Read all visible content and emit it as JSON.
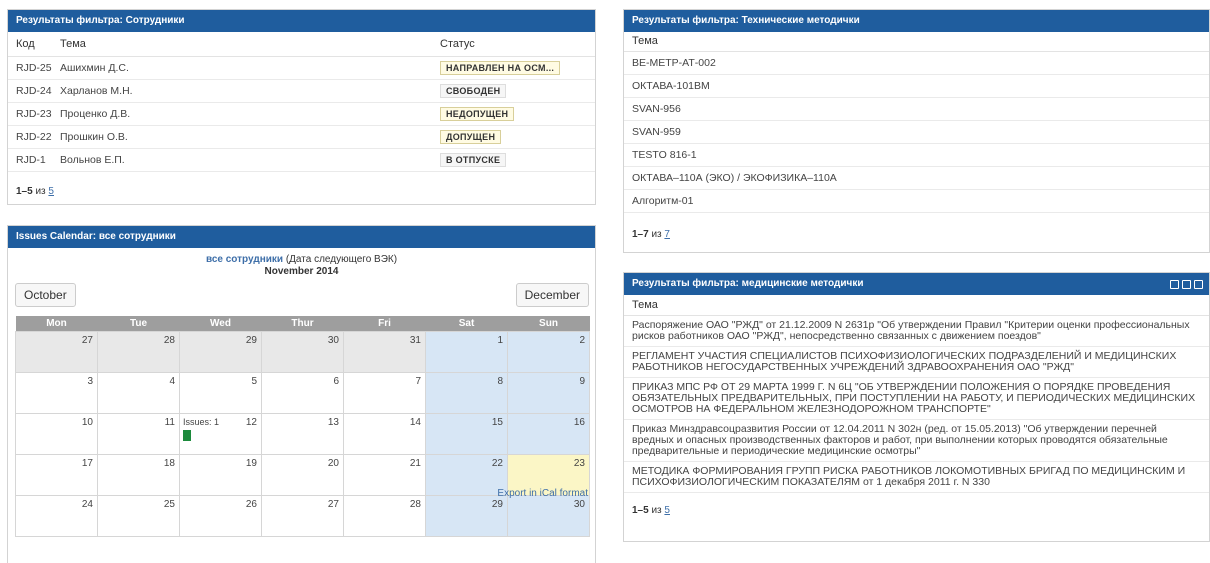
{
  "employees_panel": {
    "title": "Результаты фильтра: Сотрудники",
    "columns": [
      "Код",
      "Тема",
      "Статус"
    ],
    "rows": [
      {
        "code": "RJD-25",
        "name": "Ашихмин Д.С.",
        "status": "НАПРАВЛЕН НА ОСМ..."
      },
      {
        "code": "RJD-24",
        "name": "Харланов М.Н.",
        "status": "СВОБОДЕН"
      },
      {
        "code": "RJD-23",
        "name": "Проценко Д.В.",
        "status": "НЕДОПУЩЕН"
      },
      {
        "code": "RJD-22",
        "name": "Прошкин О.В.",
        "status": "ДОПУЩЕН"
      },
      {
        "code": "RJD-1",
        "name": "Вольнов Е.П.",
        "status": "В ОТПУСКЕ"
      }
    ],
    "pager": {
      "range": "1–5",
      "of": "из",
      "total": "5"
    }
  },
  "calendar_panel": {
    "title": "Issues Calendar: все сотрудники",
    "user_link": "все сотрудники",
    "subtitle": "(Дата следующего ВЭК)",
    "month": "November 2014",
    "prev_label": "October",
    "next_label": "December",
    "weekdays": [
      "Mon",
      "Tue",
      "Wed",
      "Thur",
      "Fri",
      "Sat",
      "Sun"
    ],
    "weeks": [
      [
        "27",
        "28",
        "29",
        "30",
        "31",
        "1",
        "2"
      ],
      [
        "3",
        "4",
        "5",
        "6",
        "7",
        "8",
        "9"
      ],
      [
        "10",
        "11",
        "12",
        "13",
        "14",
        "15",
        "16"
      ],
      [
        "17",
        "18",
        "19",
        "20",
        "21",
        "22",
        "23"
      ],
      [
        "24",
        "25",
        "26",
        "27",
        "28",
        "29",
        "30"
      ]
    ],
    "issues_label": "Issues: 1",
    "export_label": "Export in iCal format",
    "colors": {
      "weekend": "#d7e6f5",
      "other_month": "#e8e8e8",
      "today": "#fbf6c6",
      "issue": "#1c8a3c"
    }
  },
  "tech_panel": {
    "title": "Результаты фильтра: Технические методички",
    "column": "Тема",
    "rows": [
      "ВЕ-МЕТР-АТ-002",
      "ОКТАВА-101ВМ",
      "SVAN-956",
      "SVAN-959",
      "TESTO 816-1",
      "ОКТАВА–110А (ЭКО) / ЭКОФИЗИКА–110А",
      "Алгоритм-01"
    ],
    "pager": {
      "range": "1–7",
      "of": "из",
      "total": "7"
    }
  },
  "med_panel": {
    "title": "Результаты фильтра: медицинские методички",
    "column": "Тема",
    "rows": [
      "Распоряжение ОАО \"РЖД\" от 21.12.2009 N 2631р \"Об утверждении Правил \"Критерии оценки профессиональных рисков работников ОАО \"РЖД\", непосредственно связанных с движением поездов\"",
      "РЕГЛАМЕНТ УЧАСТИЯ СПЕЦИАЛИСТОВ ПСИХОФИЗИОЛОГИЧЕСКИХ ПОДРАЗДЕЛЕНИЙ И МЕДИЦИНСКИХ РАБОТНИКОВ НЕГОСУДАРСТВЕННЫХ УЧРЕЖДЕНИЙ ЗДРАВООХРАНЕНИЯ ОАО \"РЖД\"",
      "ПРИКАЗ МПС РФ ОТ 29 МАРТА 1999 Г. N 6Ц \"ОБ УТВЕРЖДЕНИИ ПОЛОЖЕНИЯ О ПОРЯДКЕ ПРОВЕДЕНИЯ ОБЯЗАТЕЛЬНЫХ ПРЕДВАРИТЕЛЬНЫХ, ПРИ ПОСТУПЛЕНИИ НА РАБОТУ, И ПЕРИОДИЧЕСКИХ МЕДИЦИНСКИХ ОСМОТРОВ НА ФЕДЕРАЛЬНОМ ЖЕЛЕЗНОДОРОЖНОМ ТРАНСПОРТЕ\"",
      "Приказ Минздравсоцразвития России от 12.04.2011 N 302н (ред. от 15.05.2013) \"Об утверждении перечней вредных и опасных производственных факторов и работ, при выполнении которых проводятся обязательные предварительные и периодические медицинские осмотры\"",
      "МЕТОДИКА ФОРМИРОВАНИЯ ГРУПП РИСКА РАБОТНИКОВ ЛОКОМОТИВНЫХ БРИГАД ПО МЕДИЦИНСКИМ И ПСИХОФИЗИОЛОГИЧЕСКИМ ПОКАЗАТЕЛЯМ от 1 декабря 2011 г. N 330"
    ],
    "pager": {
      "range": "1–5",
      "of": "из",
      "total": "5"
    },
    "header_icons": [
      "move-icon",
      "maximize-icon",
      "collapse-icon"
    ]
  }
}
